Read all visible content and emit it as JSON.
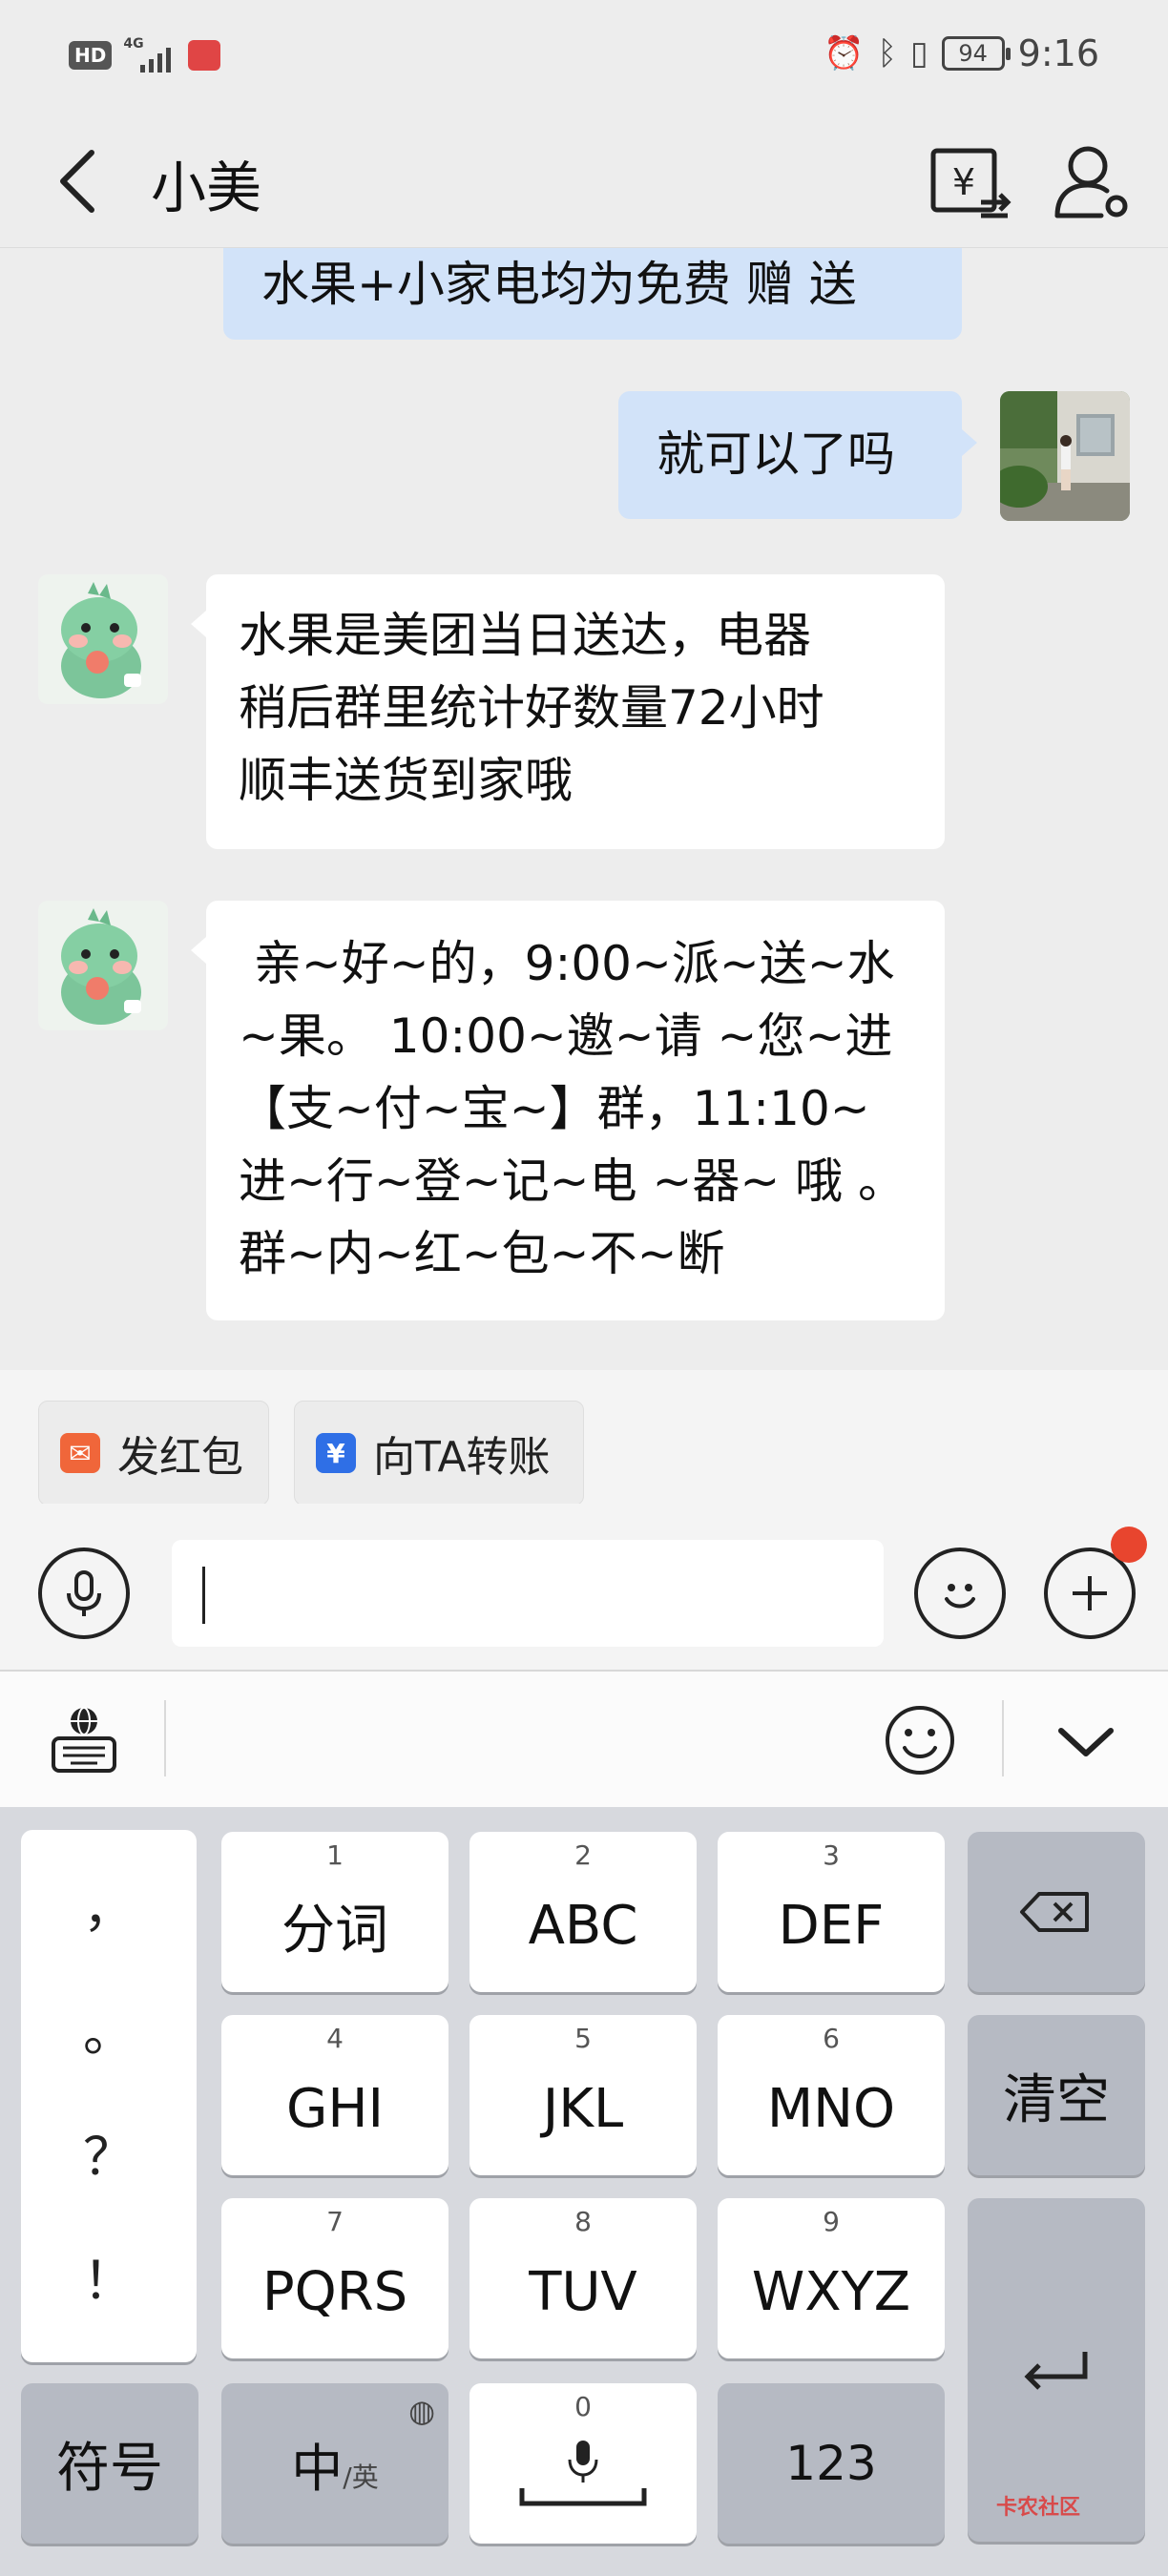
{
  "status_bar": {
    "left_badges": [
      "HD",
      "4G"
    ],
    "time": "9:16",
    "battery": "94",
    "icons": [
      "alarm-icon",
      "bluetooth-icon",
      "vibrate-icon"
    ]
  },
  "header": {
    "title": "小美",
    "back_icon": "chevron-left-icon",
    "actions": [
      "transfer-yuan-icon",
      "contact-profile-icon"
    ]
  },
  "messages": [
    {
      "direction": "out",
      "text": "水果+小家电均为免费 赠 送",
      "partial": true
    },
    {
      "direction": "out",
      "text": "就可以了吗"
    },
    {
      "direction": "in",
      "lines": [
        "水果是美团当日送达，电器",
        "稍后群里统计好数量72小时",
        "顺丰送货到家哦"
      ]
    },
    {
      "direction": "in",
      "lines": [
        " 亲~好~的，9:00~派~送~水",
        "~果。 10:00~邀~请 ~您~进",
        "【支~付~宝~】群，11:10~",
        "进~行~登~记~电 ~器~ 哦 。",
        "群~内~红~包~不~断"
      ]
    }
  ],
  "shortcuts": [
    {
      "label": "发红包",
      "icon": "red-packet-icon",
      "color": "#f0663a"
    },
    {
      "label": "向TA转账",
      "icon": "transfer-icon",
      "color": "#2f6fe6"
    }
  ],
  "input": {
    "value": "",
    "placeholder": ""
  },
  "keyboard": {
    "punctuation": [
      "，",
      "。",
      "？",
      "！"
    ],
    "keys": [
      {
        "num": "1",
        "label": "分词"
      },
      {
        "num": "2",
        "label": "ABC"
      },
      {
        "num": "3",
        "label": "DEF"
      },
      {
        "num": "4",
        "label": "GHI"
      },
      {
        "num": "5",
        "label": "JKL"
      },
      {
        "num": "6",
        "label": "MNO"
      },
      {
        "num": "7",
        "label": "PQRS"
      },
      {
        "num": "8",
        "label": "TUV"
      },
      {
        "num": "9",
        "label": "WXYZ"
      }
    ],
    "clear_label": "清空",
    "symbol_label": "符号",
    "lang_label": "中",
    "lang_sub": "/英",
    "space_num": "0",
    "num_label": "123"
  },
  "watermark": "卡农社区",
  "colors": {
    "background": "#ededed",
    "out_bubble": "#d2e3f9",
    "in_bubble": "#ffffff",
    "keyboard": "#d7d9de"
  }
}
